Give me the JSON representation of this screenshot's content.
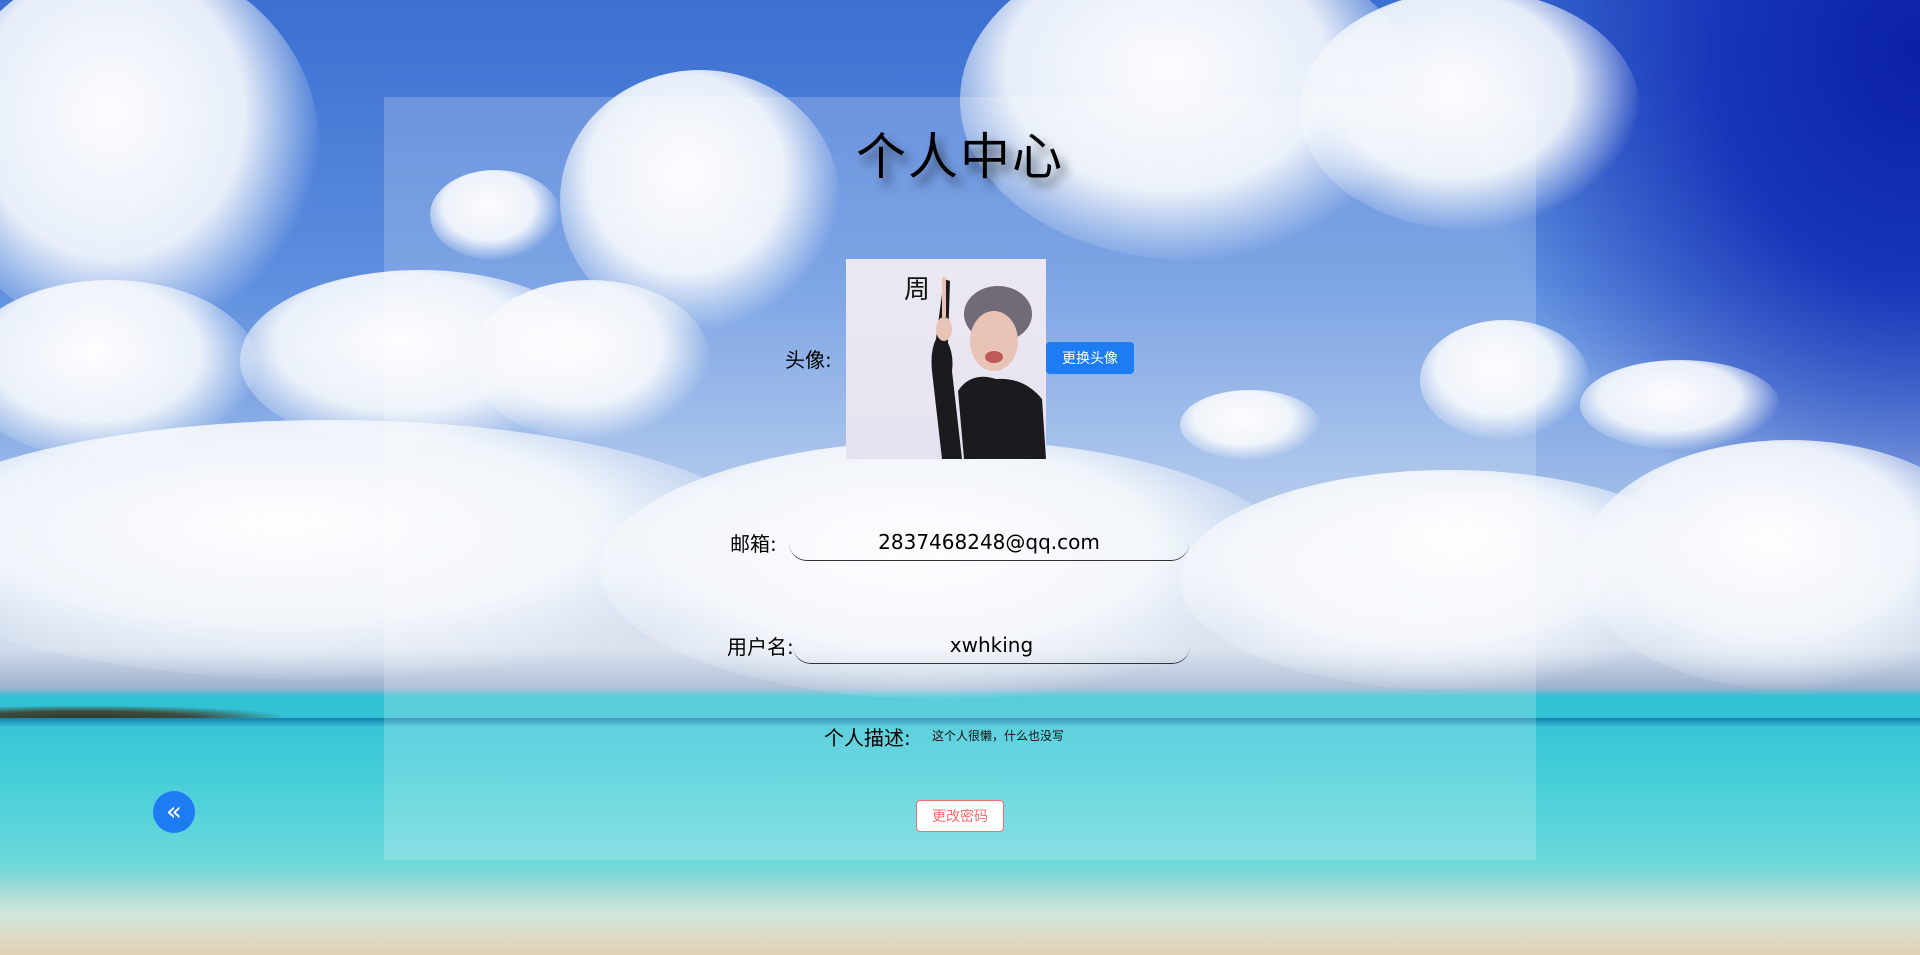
{
  "page": {
    "title": "个人中心"
  },
  "profile": {
    "avatar_label": "头像:",
    "avatar_caption": "周",
    "change_avatar_button": "更换头像",
    "email_label": "邮箱:",
    "email_value": "2837468248@qq.com",
    "username_label": "用户名:",
    "username_value": "xwhking",
    "description_label": "个人描述:",
    "description_value": "这个人很懒，什么也没写",
    "change_password_button": "更改密码"
  },
  "navigation": {
    "back_icon": "double-chevron-left-icon",
    "back_glyph": "«"
  },
  "colors": {
    "primary": "#1e7cf2",
    "danger": "#f56c6c",
    "panel": "rgba(255,255,255,0.20)"
  }
}
